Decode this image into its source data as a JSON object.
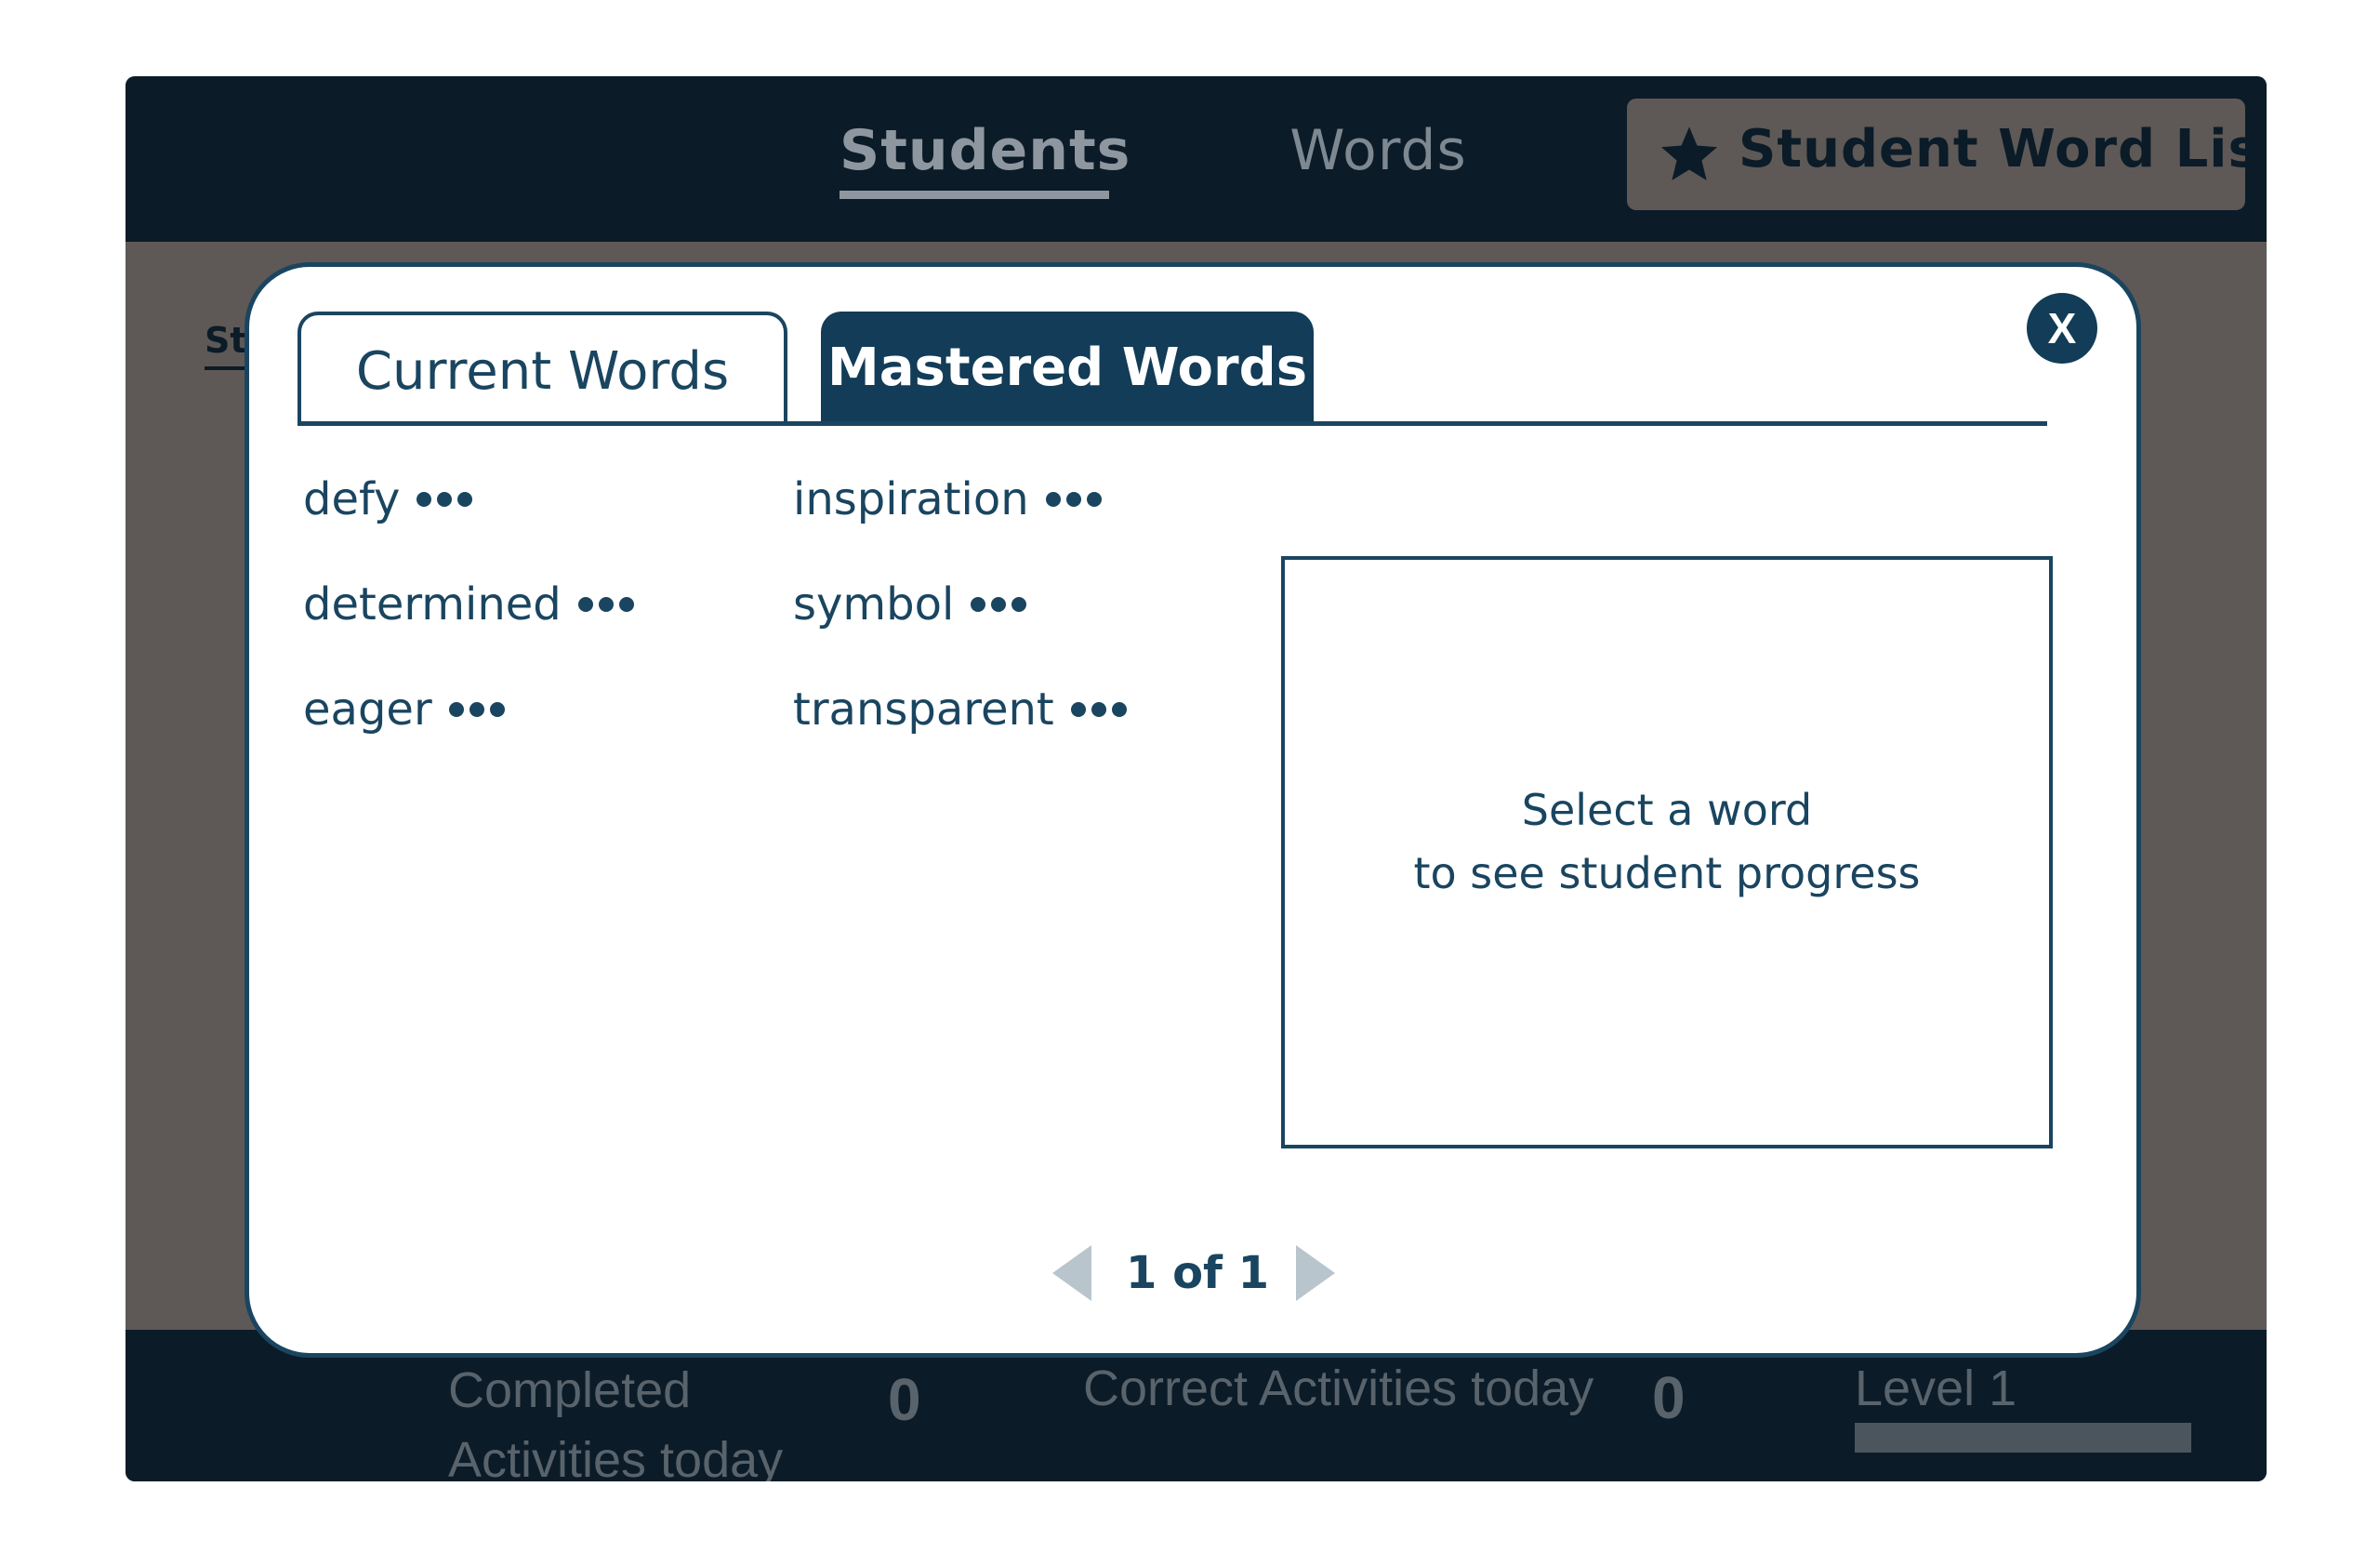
{
  "nav": {
    "students_label": "Students",
    "words_label": "Words",
    "word_list_button": "Student Word List",
    "star_icon": "star-icon"
  },
  "background": {
    "truncated_label": "St",
    "stats": {
      "completed_label": "Completed Activities today",
      "completed_value": "0",
      "correct_label": "Correct Activities today",
      "correct_value": "0",
      "level_label": "Level 1"
    }
  },
  "modal": {
    "close_label": "X",
    "tabs": [
      {
        "label": "Current Words",
        "active": false
      },
      {
        "label": "Mastered Words",
        "active": true
      }
    ],
    "words": [
      {
        "word": "defy"
      },
      {
        "word": "determined"
      },
      {
        "word": "eager"
      },
      {
        "word": "inspiration"
      },
      {
        "word": "symbol"
      },
      {
        "word": "transparent"
      }
    ],
    "progress_panel": {
      "line1": "Select a word",
      "line2": "to see student progress"
    },
    "pager": {
      "label": "1 of 1"
    }
  },
  "colors": {
    "navy": "#0b1b28",
    "accent": "#1a4560",
    "overlay": "#5e5956"
  }
}
